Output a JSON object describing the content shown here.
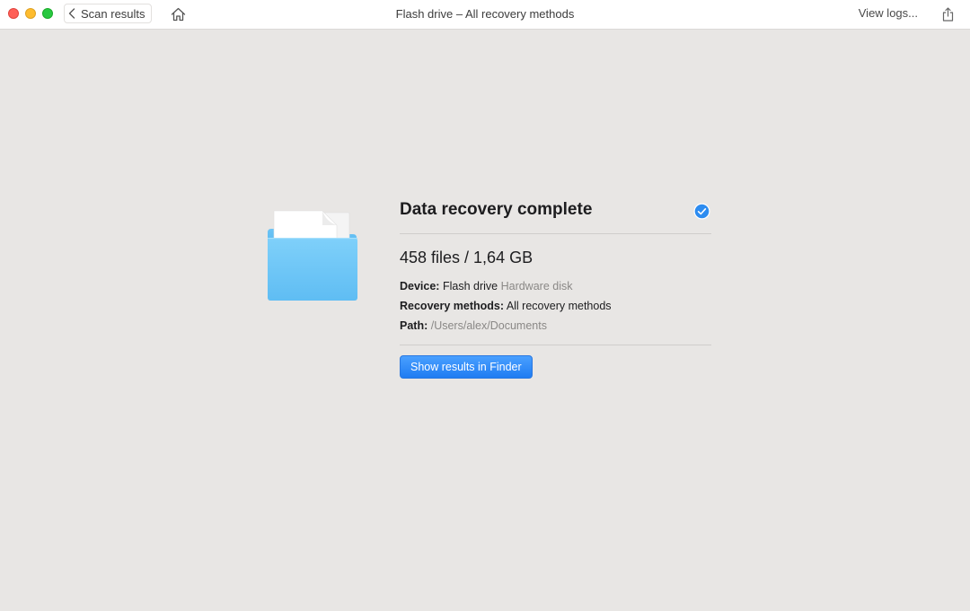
{
  "window": {
    "title": "Flash drive – All recovery methods",
    "back_label": "Scan results",
    "view_logs_label": "View logs..."
  },
  "result": {
    "heading": "Data recovery complete",
    "summary": "458 files / 1,64 GB",
    "device_label": "Device:",
    "device_value": "Flash drive",
    "device_type": "Hardware disk",
    "methods_label": "Recovery methods:",
    "methods_value": "All recovery methods",
    "path_label": "Path:",
    "path_value": "/Users/alex/Documents",
    "button_label": "Show results in Finder"
  },
  "icons": {
    "folder": "folder-with-documents-icon",
    "check": "checkmark-circle-icon",
    "home": "home-icon",
    "share": "share-icon",
    "back": "chevron-left-icon"
  },
  "colors": {
    "accent": "#1f7cf2",
    "folder_blue": "#6ec6f7",
    "check_blue": "#2d8cf0",
    "background": "#e8e6e4"
  }
}
